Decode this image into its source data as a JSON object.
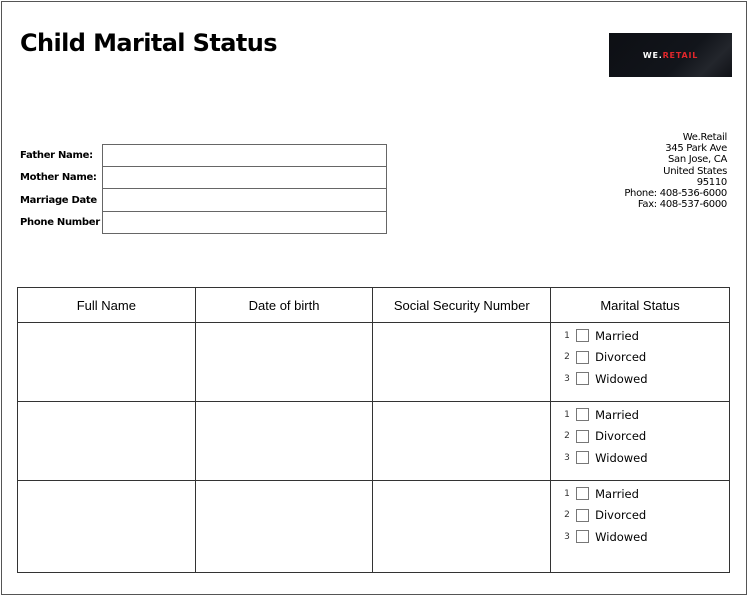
{
  "title": "Child Marital Status",
  "logo": {
    "part1": "WE.",
    "part2": "RETAIL"
  },
  "fields": [
    {
      "label": "Father Name:",
      "value": ""
    },
    {
      "label": "Mother Name:",
      "value": ""
    },
    {
      "label": "Marriage Date",
      "value": ""
    },
    {
      "label": "Phone Number",
      "value": ""
    }
  ],
  "address": {
    "company": "We.Retail",
    "street": "345 Park Ave",
    "city": "San Jose, CA",
    "country": "United States",
    "zip": "95110",
    "phone": "Phone: 408-536-6000",
    "fax": "Fax: 408-537-6000"
  },
  "table": {
    "headers": [
      "Full Name",
      "Date of birth",
      "Social Security Number",
      "Marital Status"
    ],
    "options": [
      {
        "num": "1",
        "label": "Married"
      },
      {
        "num": "2",
        "label": "Divorced"
      },
      {
        "num": "3",
        "label": "Widowed"
      }
    ]
  }
}
